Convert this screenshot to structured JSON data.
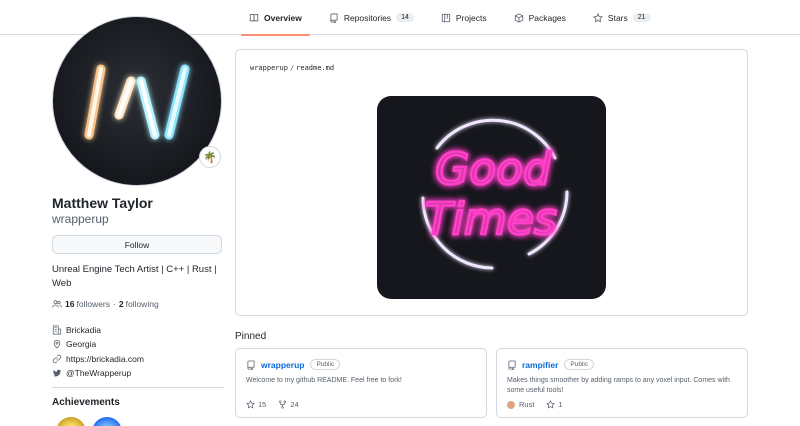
{
  "nav": {
    "tabs": [
      {
        "label": "Overview",
        "icon": "book-icon",
        "selected": true
      },
      {
        "label": "Repositories",
        "icon": "repo-icon",
        "count": "14"
      },
      {
        "label": "Projects",
        "icon": "project-icon"
      },
      {
        "label": "Packages",
        "icon": "package-icon"
      },
      {
        "label": "Stars",
        "icon": "star-icon",
        "count": "21"
      }
    ],
    "accent_color": "#fd8c73"
  },
  "profile": {
    "status_emoji": "🌴",
    "full_name": "Matthew Taylor",
    "username": "wrapperup",
    "follow_label": "Follow",
    "bio": "Unreal Engine Tech Artist | C++ | Rust | Web",
    "followers_count": "16",
    "followers_label": "followers",
    "separator": "·",
    "following_count": "2",
    "following_label": "following",
    "company": "Brickadia",
    "location": "Georgia",
    "website": "https://brickadia.com",
    "twitter": "@TheWrapperup",
    "achievements_title": "Achievements"
  },
  "readme": {
    "owner": "wrapperup",
    "slash": "/",
    "file": "readme.md",
    "neon_line1": "Good",
    "neon_line2": "Times"
  },
  "pinned": {
    "title": "Pinned",
    "repos": [
      {
        "name": "wrapperup",
        "visibility": "Public",
        "description": "Welcome to my github README. Feel free to fork!",
        "stars": "15",
        "forks": "24"
      },
      {
        "name": "rampifier",
        "visibility": "Public",
        "description": "Makes things smoother by adding ramps to any voxel input. Comes with some useful tools!",
        "language": "Rust",
        "language_color": "#dea584",
        "stars": "1"
      }
    ]
  },
  "colors": {
    "link": "#0969da",
    "border": "#d0d7de",
    "muted": "#57606a"
  }
}
